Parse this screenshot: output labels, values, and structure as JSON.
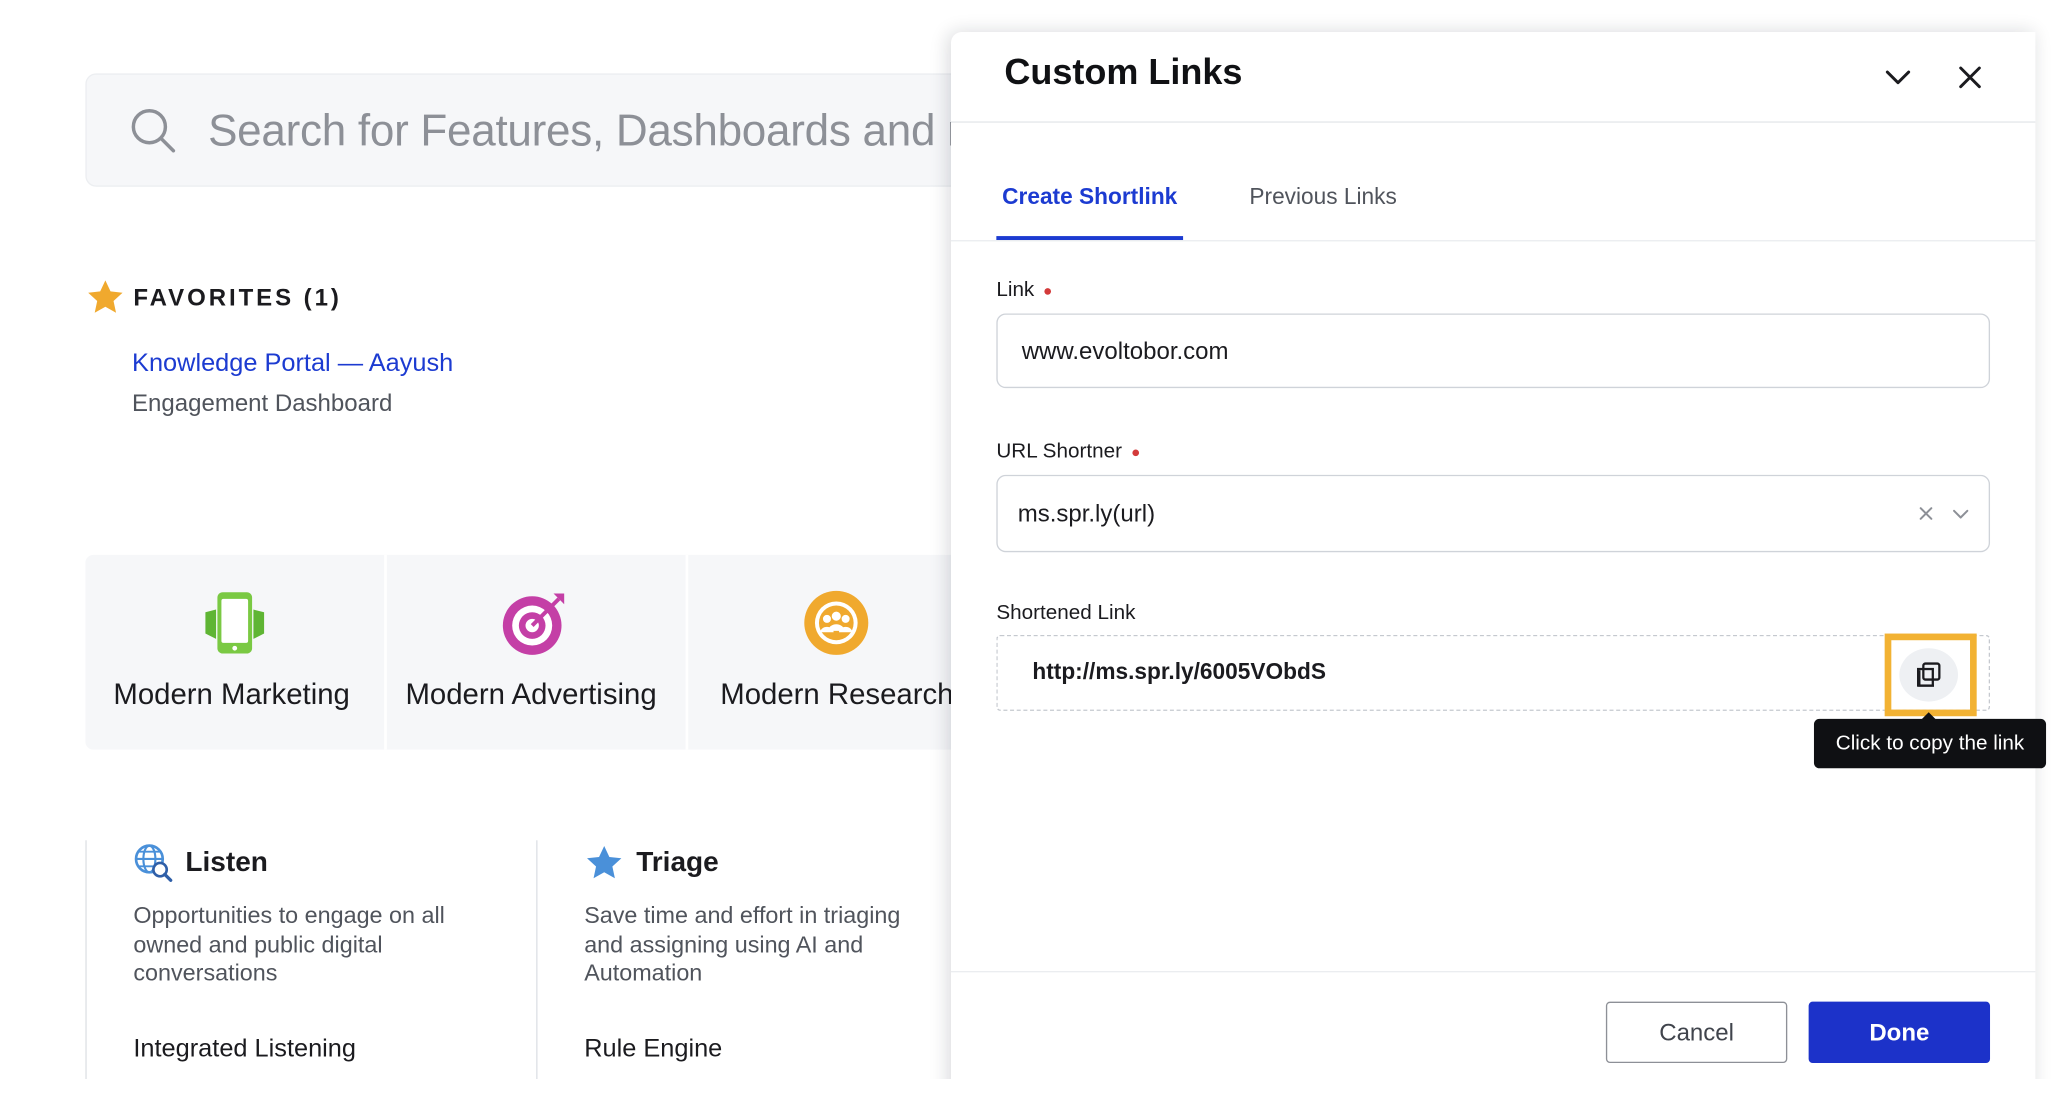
{
  "search": {
    "placeholder": "Search for Features, Dashboards and m"
  },
  "favorites": {
    "title": "FAVORITES (1)",
    "items": [
      {
        "name": "Knowledge Portal — Aayush",
        "subtitle": "Engagement Dashboard"
      }
    ]
  },
  "tiles": [
    {
      "label": "Modern Marketing",
      "icon": "phone-icon"
    },
    {
      "label": "Modern Advertising",
      "icon": "target-icon"
    },
    {
      "label": "Modern Research",
      "icon": "research-group-icon"
    }
  ],
  "cards": [
    {
      "title": "Listen",
      "icon": "globe-search-icon",
      "description": "Opportunities to engage on all owned and public digital conversations",
      "item": "Integrated Listening"
    },
    {
      "title": "Triage",
      "icon": "star-icon",
      "description": "Save time and effort in triaging and assigning using AI and Automation",
      "item": "Rule Engine"
    }
  ],
  "drawer": {
    "title": "Custom Links",
    "tabs": [
      {
        "label": "Create Shortlink",
        "active": true
      },
      {
        "label": "Previous Links",
        "active": false
      }
    ],
    "link": {
      "label": "Link",
      "value": "www.evoltobor.com"
    },
    "shortener": {
      "label": "URL Shortner",
      "value": "ms.spr.ly(url)"
    },
    "shortened": {
      "label": "Shortened Link",
      "value": "http://ms.spr.ly/6005VObdS"
    },
    "tooltip": "Click to copy the link",
    "buttons": {
      "cancel": "Cancel",
      "done": "Done"
    }
  },
  "colors": {
    "accent": "#1c3bd1",
    "primary_button": "#1c32c9",
    "highlight": "#f2b233",
    "required": "#d33a3a"
  }
}
